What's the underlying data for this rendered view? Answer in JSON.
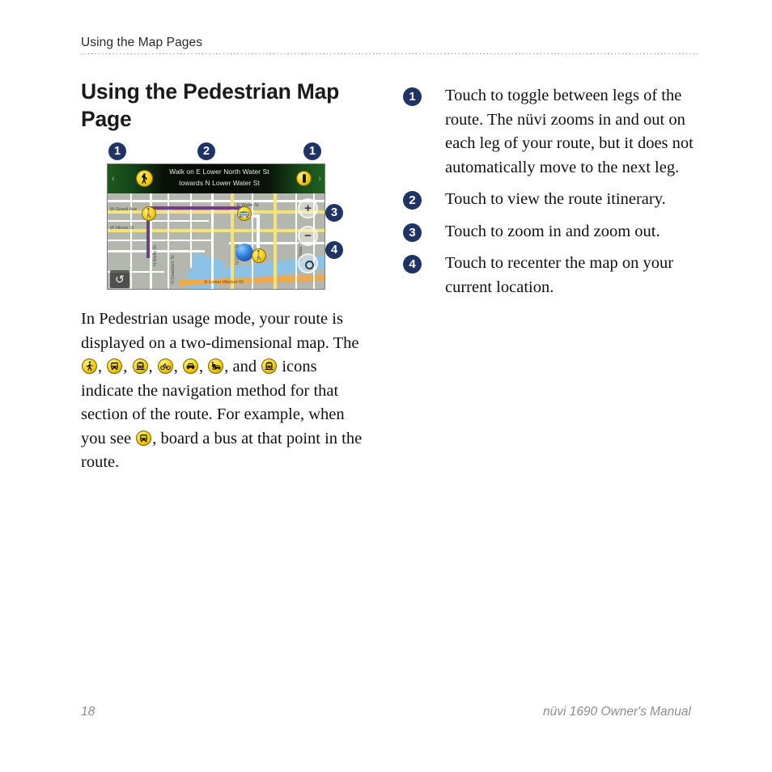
{
  "running_head": "Using the Map Pages",
  "section": {
    "title": "Using the Pedestrian Map Page"
  },
  "figure": {
    "callouts_above": [
      "1",
      "2",
      "1"
    ],
    "callouts_side": [
      "3",
      "4"
    ],
    "device": {
      "banner": {
        "line1": "Walk on E Lower North Water St",
        "line2": "towards N Lower Water St",
        "left_arrow": "‹",
        "right_arrow": "›",
        "walker_icon": "pedestrian-icon",
        "info_icon": "info-icon"
      },
      "controls": {
        "zoom_in": "+",
        "zoom_out": "−",
        "recenter": "recenter-icon",
        "back": "↺"
      },
      "street_labels": [
        "W Grand Ave",
        "W Illinois St",
        "N Wells St",
        "N Dearborn St",
        "N Clark St",
        "E Water St",
        "N State St",
        "E Lower Wacker Dr"
      ],
      "pois": [
        "pedestrian-icon",
        "bus-icon",
        "pedestrian-icon"
      ],
      "position_marker": "current-position-dot"
    }
  },
  "body": {
    "p1_a": "In Pedestrian usage mode, your route is displayed on a two-dimensional map. The ",
    "p1_b": ", ",
    "p1_c": ", ",
    "p1_d": ", ",
    "p1_e": ", ",
    "p1_f": ", ",
    "p1_g": ", and ",
    "p1_h": " icons indicate the navigation method for that section of the route. For example, when you see ",
    "p1_i": ", board a bus at that point in the route.",
    "inline_icons": [
      "walk-icon",
      "bus-icon",
      "train-icon",
      "bicycle-icon",
      "car-icon",
      "taxi-icon",
      "rail-icon",
      "bus-icon"
    ]
  },
  "notes": [
    {
      "num": "1",
      "text": "Touch to toggle between legs of the route. The nüvi zooms in and out on each leg of your route, but it does not automatically move to the next leg."
    },
    {
      "num": "2",
      "text": "Touch to view the route itinerary."
    },
    {
      "num": "3",
      "text": "Touch to zoom in and zoom out."
    },
    {
      "num": "4",
      "text": "Touch to recenter the map on your current location."
    }
  ],
  "footer": {
    "page_number": "18",
    "manual_title": "nüvi 1690 Owner's Manual"
  },
  "colors": {
    "callout_navy": "#1f3464",
    "icon_yellow": "#f4ce0e",
    "footer_gray": "#8d8d8d",
    "banner_green": "#1d5a1c"
  }
}
